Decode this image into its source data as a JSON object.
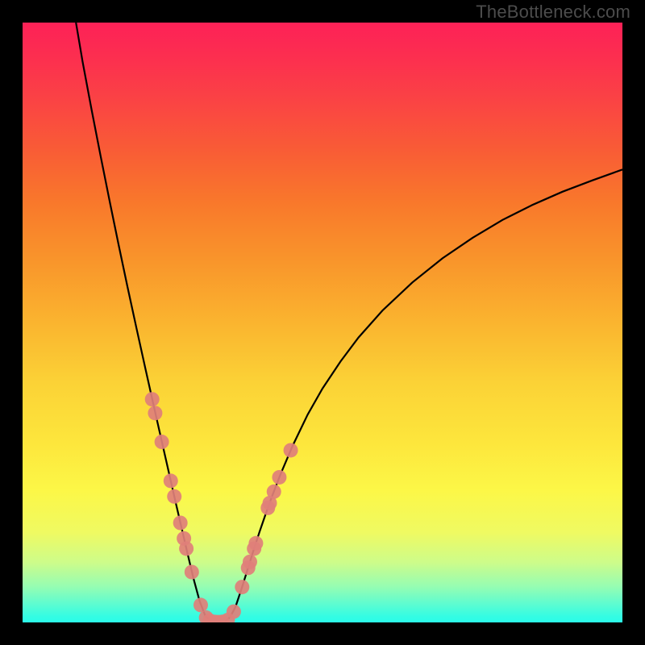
{
  "watermark": "TheBottleneck.com",
  "chart_data": {
    "type": "line",
    "title": "",
    "xlabel": "",
    "ylabel": "",
    "xlim": [
      0,
      100
    ],
    "ylim": [
      0,
      100
    ],
    "left_curve_points": [
      {
        "x": 8.9,
        "y": 100.0
      },
      {
        "x": 10.0,
        "y": 93.5
      },
      {
        "x": 11.5,
        "y": 85.5
      },
      {
        "x": 13.0,
        "y": 77.8
      },
      {
        "x": 14.5,
        "y": 70.3
      },
      {
        "x": 16.0,
        "y": 63.0
      },
      {
        "x": 17.5,
        "y": 55.9
      },
      {
        "x": 19.0,
        "y": 49.0
      },
      {
        "x": 20.5,
        "y": 42.2
      },
      {
        "x": 21.6,
        "y": 37.3
      },
      {
        "x": 22.5,
        "y": 33.3
      },
      {
        "x": 23.5,
        "y": 28.9
      },
      {
        "x": 24.5,
        "y": 24.5
      },
      {
        "x": 25.5,
        "y": 20.1
      },
      {
        "x": 26.5,
        "y": 15.8
      },
      {
        "x": 27.5,
        "y": 11.5
      },
      {
        "x": 28.5,
        "y": 7.3
      },
      {
        "x": 29.5,
        "y": 3.6
      },
      {
        "x": 30.5,
        "y": 1.0
      },
      {
        "x": 31.5,
        "y": 0.2
      },
      {
        "x": 32.2,
        "y": 0.05
      }
    ],
    "right_curve_points": [
      {
        "x": 33.0,
        "y": 0.05
      },
      {
        "x": 33.8,
        "y": 0.2
      },
      {
        "x": 34.6,
        "y": 0.9
      },
      {
        "x": 35.5,
        "y": 2.6
      },
      {
        "x": 36.5,
        "y": 5.6
      },
      {
        "x": 37.5,
        "y": 8.8
      },
      {
        "x": 38.5,
        "y": 12.0
      },
      {
        "x": 39.5,
        "y": 15.1
      },
      {
        "x": 40.5,
        "y": 18.0
      },
      {
        "x": 41.5,
        "y": 20.8
      },
      {
        "x": 43.0,
        "y": 24.7
      },
      {
        "x": 45.0,
        "y": 29.4
      },
      {
        "x": 47.5,
        "y": 34.6
      },
      {
        "x": 50.0,
        "y": 39.0
      },
      {
        "x": 53.0,
        "y": 43.5
      },
      {
        "x": 56.0,
        "y": 47.5
      },
      {
        "x": 60.0,
        "y": 52.0
      },
      {
        "x": 65.0,
        "y": 56.7
      },
      {
        "x": 70.0,
        "y": 60.7
      },
      {
        "x": 75.0,
        "y": 64.1
      },
      {
        "x": 80.0,
        "y": 67.1
      },
      {
        "x": 85.0,
        "y": 69.6
      },
      {
        "x": 90.0,
        "y": 71.8
      },
      {
        "x": 95.0,
        "y": 73.7
      },
      {
        "x": 100.0,
        "y": 75.5
      }
    ],
    "markers_left": [
      {
        "x": 21.6,
        "y": 37.2
      },
      {
        "x": 22.1,
        "y": 34.9
      },
      {
        "x": 23.2,
        "y": 30.1
      },
      {
        "x": 24.7,
        "y": 23.6
      },
      {
        "x": 25.3,
        "y": 21.0
      },
      {
        "x": 26.3,
        "y": 16.6
      },
      {
        "x": 26.9,
        "y": 14.0
      },
      {
        "x": 27.3,
        "y": 12.3
      },
      {
        "x": 28.2,
        "y": 8.4
      },
      {
        "x": 29.7,
        "y": 2.9
      },
      {
        "x": 30.6,
        "y": 0.8
      }
    ],
    "markers_bottom": [
      {
        "x": 31.2,
        "y": 0.3
      },
      {
        "x": 32.0,
        "y": 0.08
      },
      {
        "x": 32.6,
        "y": 0.05
      },
      {
        "x": 33.3,
        "y": 0.1
      },
      {
        "x": 34.2,
        "y": 0.4
      }
    ],
    "markers_right": [
      {
        "x": 35.2,
        "y": 1.8
      },
      {
        "x": 36.6,
        "y": 5.9
      },
      {
        "x": 37.6,
        "y": 9.1
      },
      {
        "x": 37.9,
        "y": 10.1
      },
      {
        "x": 38.6,
        "y": 12.3
      },
      {
        "x": 38.9,
        "y": 13.2
      },
      {
        "x": 40.9,
        "y": 19.1
      },
      {
        "x": 41.2,
        "y": 19.9
      },
      {
        "x": 41.9,
        "y": 21.8
      },
      {
        "x": 42.8,
        "y": 24.2
      },
      {
        "x": 44.7,
        "y": 28.7
      }
    ],
    "marker_radius_px": 9
  }
}
